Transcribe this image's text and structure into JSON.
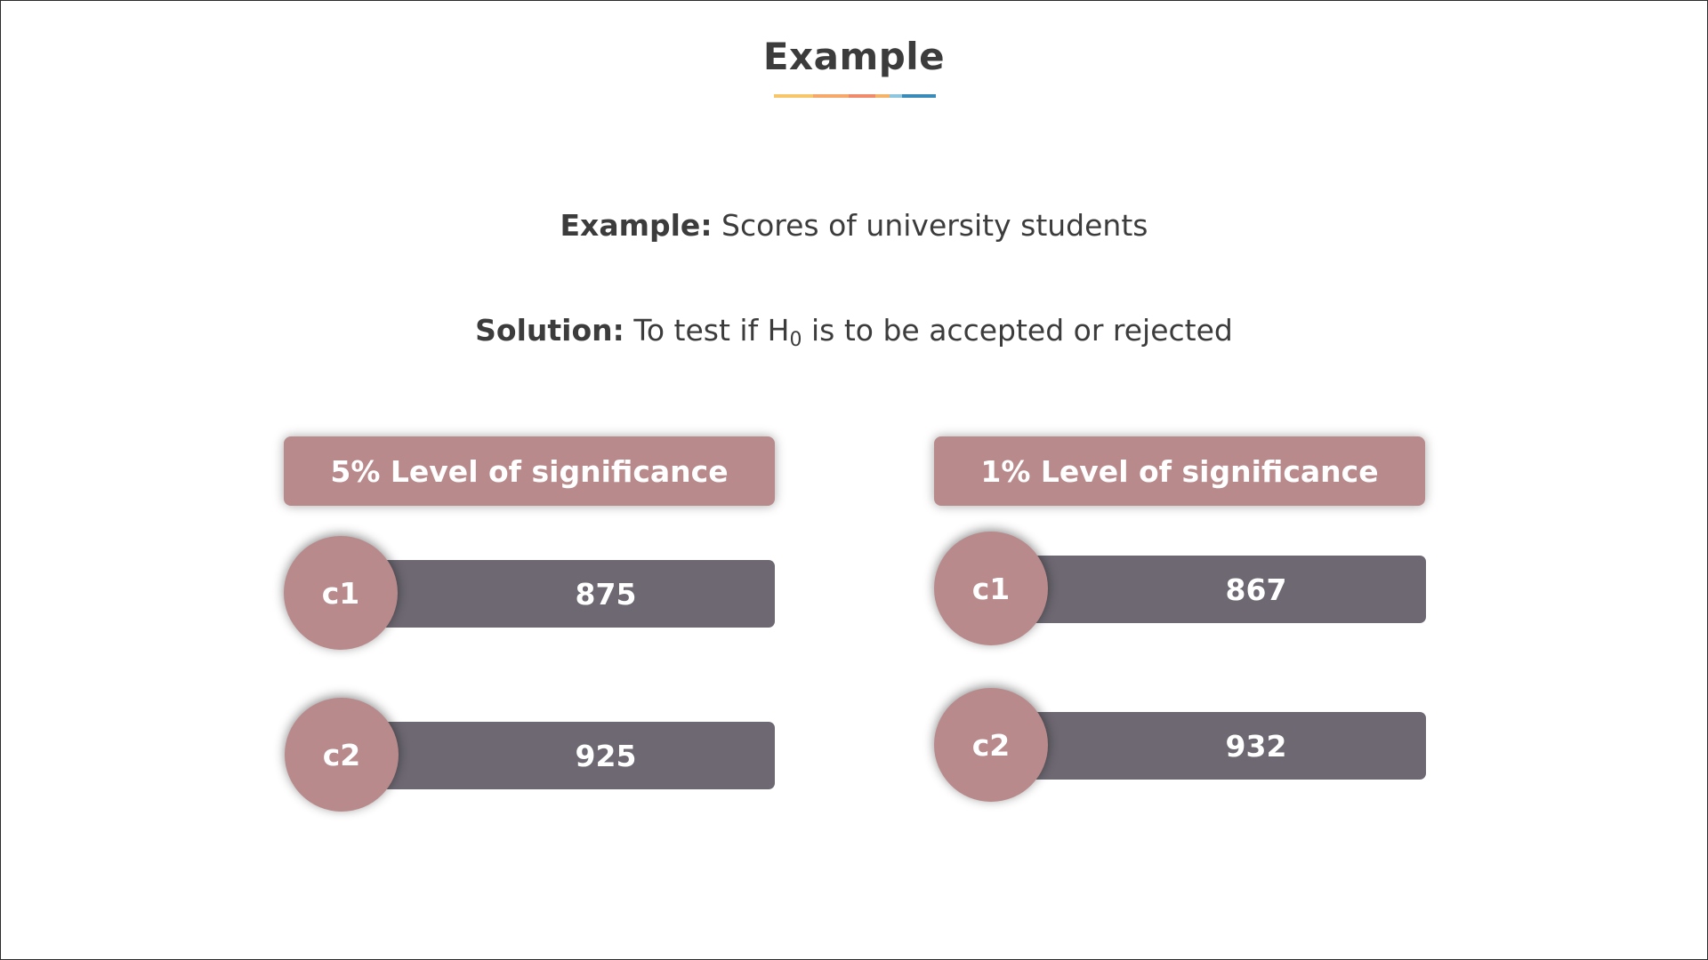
{
  "slide": {
    "title": "Example",
    "example_label": "Example:",
    "example_text": " Scores of university students",
    "solution_label": "Solution:",
    "solution_text_before": " To test if H",
    "solution_subscript": "0",
    "solution_text_after": " is to be accepted or rejected"
  },
  "panels": [
    {
      "header": "5% Level of significance",
      "rows": [
        {
          "label": "c1",
          "value": "875"
        },
        {
          "label": "c2",
          "value": "925"
        }
      ]
    },
    {
      "header": "1% Level of significance",
      "rows": [
        {
          "label": "c1",
          "value": "867"
        },
        {
          "label": "c2",
          "value": "932"
        }
      ]
    }
  ],
  "colors": {
    "accent_rose": "#b98a8c",
    "bar_gray": "#6d6872",
    "text_dark": "#3c3c3c",
    "underline": [
      "#f7c56a",
      "#f5a86a",
      "#ef8a6b",
      "#f5b36a",
      "#8fc6df",
      "#3a8bb8"
    ]
  }
}
